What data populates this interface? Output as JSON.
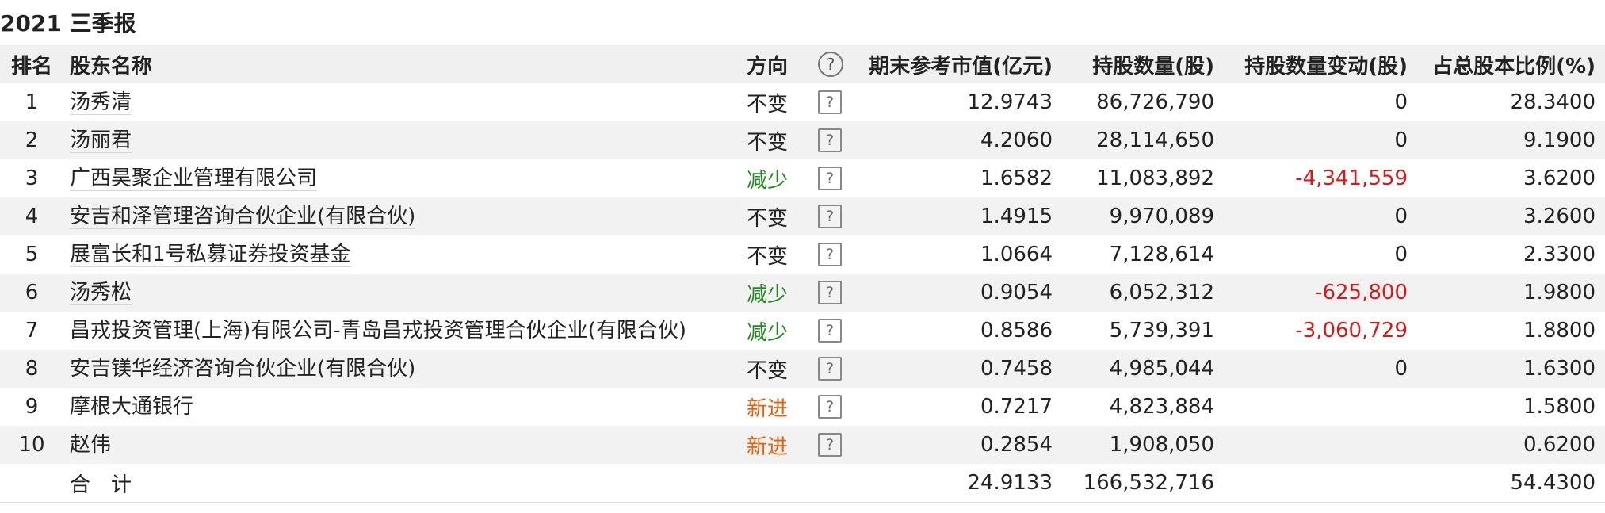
{
  "report": {
    "title": "2021 三季报"
  },
  "headers": {
    "rank": "排名",
    "name": "股东名称",
    "direction": "方向",
    "help_icon": "?",
    "market_value": "期末参考市值(亿元)",
    "shares": "持股数量(股)",
    "change": "持股数量变动(股)",
    "ratio": "占总股本比例(%)"
  },
  "rows": [
    {
      "rank": "1",
      "name": "汤秀清",
      "direction": "不变",
      "help": "?",
      "market_value": "12.9743",
      "shares": "86,726,790",
      "change": "0",
      "ratio": "28.3400"
    },
    {
      "rank": "2",
      "name": "汤丽君",
      "direction": "不变",
      "help": "?",
      "market_value": "4.2060",
      "shares": "28,114,650",
      "change": "0",
      "ratio": "9.1900"
    },
    {
      "rank": "3",
      "name": "广西昊聚企业管理有限公司",
      "direction": "减少",
      "help": "?",
      "market_value": "1.6582",
      "shares": "11,083,892",
      "change": "-4,341,559",
      "ratio": "3.6200"
    },
    {
      "rank": "4",
      "name": "安吉和泽管理咨询合伙企业(有限合伙)",
      "direction": "不变",
      "help": "?",
      "market_value": "1.4915",
      "shares": "9,970,089",
      "change": "0",
      "ratio": "3.2600"
    },
    {
      "rank": "5",
      "name": "展富长和1号私募证券投资基金",
      "direction": "不变",
      "help": "?",
      "market_value": "1.0664",
      "shares": "7,128,614",
      "change": "0",
      "ratio": "2.3300"
    },
    {
      "rank": "6",
      "name": "汤秀松",
      "direction": "减少",
      "help": "?",
      "market_value": "0.9054",
      "shares": "6,052,312",
      "change": "-625,800",
      "ratio": "1.9800"
    },
    {
      "rank": "7",
      "name": "昌戎投资管理(上海)有限公司-青岛昌戎投资管理合伙企业(有限合伙)",
      "direction": "减少",
      "help": "?",
      "market_value": "0.8586",
      "shares": "5,739,391",
      "change": "-3,060,729",
      "ratio": "1.8800"
    },
    {
      "rank": "8",
      "name": "安吉镁华经济咨询合伙企业(有限合伙)",
      "direction": "不变",
      "help": "?",
      "market_value": "0.7458",
      "shares": "4,985,044",
      "change": "0",
      "ratio": "1.6300"
    },
    {
      "rank": "9",
      "name": "摩根大通银行",
      "direction": "新进",
      "help": "?",
      "market_value": "0.7217",
      "shares": "4,823,884",
      "change": "",
      "ratio": "1.5800"
    },
    {
      "rank": "10",
      "name": "赵伟",
      "direction": "新进",
      "help": "?",
      "market_value": "0.2854",
      "shares": "1,908,050",
      "change": "",
      "ratio": "0.6200"
    }
  ],
  "total": {
    "label": "合　计",
    "market_value": "24.9133",
    "shares": "166,532,716",
    "ratio": "54.4300"
  },
  "colors": {
    "unchanged": "#222222",
    "decrease": "#1f8c1f",
    "new": "#e2620f",
    "negative_change": "#d81818",
    "header_bg": "#f0f0f0",
    "stripe_bg": "#f2f2f2"
  }
}
